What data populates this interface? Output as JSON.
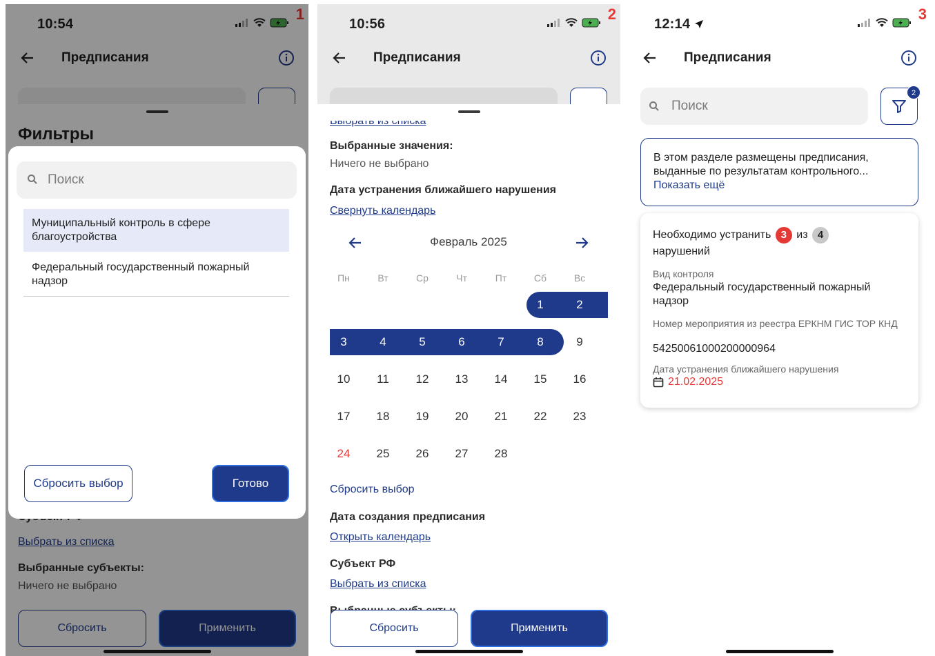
{
  "screens": [
    {
      "index": "1",
      "time": "10:54",
      "title": "Предписания",
      "sheet_title": "Фильтры",
      "dialog": {
        "search_placeholder": "Поиск",
        "options": [
          "Муниципальный контроль в сфере благоустройства",
          "Федеральный государственный пожарный надзор"
        ],
        "reset_label": "Сбросить выбор",
        "done_label": "Готово"
      },
      "below": {
        "subject_label_partial": "Субъект РФ",
        "choose_link": "Выбрать из списка",
        "selected_subjects_label": "Выбранные субъекты:",
        "selected_subjects_value": "Ничего не выбрано"
      },
      "reset_label": "Сбросить",
      "apply_label": "Применить"
    },
    {
      "index": "2",
      "time": "10:56",
      "title": "Предписания",
      "top_link_partial": "Выбрать из списка",
      "selected_values_label": "Выбранные значения:",
      "selected_values_value": "Ничего не выбрано",
      "nearest_label": "Дата устранения ближайшего нарушения",
      "collapse_link": "Свернуть календарь",
      "calendar": {
        "month": "Февраль 2025",
        "weekdays": [
          "Пн",
          "Вт",
          "Ср",
          "Чт",
          "Пт",
          "Сб",
          "Вс"
        ],
        "weeks": [
          [
            "",
            "",
            "",
            "",
            "",
            "1",
            "2"
          ],
          [
            "3",
            "4",
            "5",
            "6",
            "7",
            "8",
            "9"
          ],
          [
            "10",
            "11",
            "12",
            "13",
            "14",
            "15",
            "16"
          ],
          [
            "17",
            "18",
            "19",
            "20",
            "21",
            "22",
            "23"
          ],
          [
            "24",
            "25",
            "26",
            "27",
            "28",
            "",
            ""
          ]
        ],
        "range_start": "1",
        "range_end": "8",
        "today": "24"
      },
      "reset_choice": "Сбросить выбор",
      "created_label": "Дата создания предписания",
      "open_calendar": "Открыть календарь",
      "subject_label": "Субъект РФ",
      "choose_link": "Выбрать из списка",
      "selected_subjects_partial": "Выбранные субъекты:",
      "reset_label": "Сбросить",
      "apply_label": "Применить"
    },
    {
      "index": "3",
      "time": "12:14",
      "title": "Предписания",
      "search_placeholder": "Поиск",
      "filter_count": "2",
      "notice_text": "В этом разделе размещены предписания, выданные по результатам контрольного...",
      "notice_more": "Показать ещё",
      "card": {
        "need_prefix": "Необходимо устранить",
        "need_count": "3",
        "of_word": "из",
        "total_count": "4",
        "need_suffix": "нарушений",
        "control_type_label": "Вид контроля",
        "control_type_value": "Федеральный государственный пожарный надзор",
        "event_label": "Номер мероприятия из реестра ЕРКНМ ГИС ТОР КНД",
        "event_value": "54250061000200000964",
        "due_label": "Дата устранения ближайшего нарушения",
        "due_value": "21.02.2025"
      }
    }
  ],
  "colors": {
    "accent": "#1f3a8a",
    "danger": "#e53935",
    "selected_option_bg": "#e6eaf8",
    "overlay": "rgba(0,0,0,0.42)"
  }
}
